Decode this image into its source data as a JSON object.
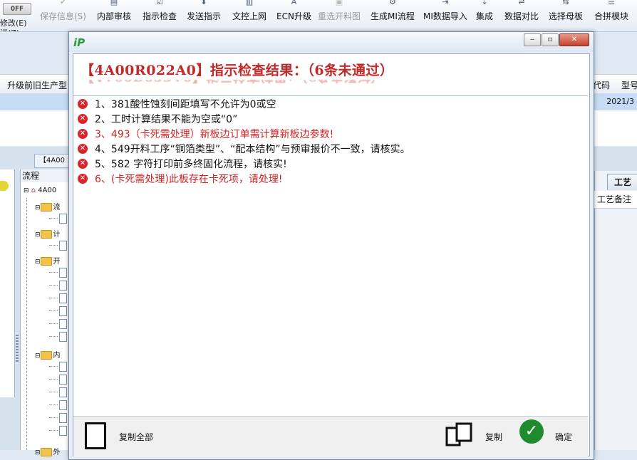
{
  "toolbar": {
    "switch_label": "OFF",
    "left_small_1": "修改(E)",
    "left_small_2": "消(Z)",
    "buttons": [
      {
        "label": "保存信息(S)",
        "icon": "check-icon",
        "disabled": true
      },
      {
        "label": "内部审核",
        "icon": "printer-icon"
      },
      {
        "label": "指示检查",
        "icon": "clipboard-check-icon"
      },
      {
        "label": "发送指示",
        "icon": "download-icon"
      },
      {
        "label": "文控上网",
        "icon": "document-icon"
      },
      {
        "label": "ECN升级",
        "icon": "letter-a-icon"
      },
      {
        "label": "重选开料图",
        "icon": "image-icon",
        "disabled": true
      },
      {
        "label": "生成MI流程",
        "icon": "gears-icon"
      },
      {
        "label": "MI数据导入",
        "icon": "import-icon"
      },
      {
        "label": "集成",
        "icon": "download-tray-icon"
      },
      {
        "label": "数据对比",
        "icon": "compare-icon"
      },
      {
        "label": "选择母板",
        "icon": "arrows-icon"
      },
      {
        "label": "合拼模块",
        "icon": "list-icon"
      }
    ]
  },
  "grid": {
    "col_left": "升级前旧生产型",
    "col_code": "代码",
    "col_model": "型号",
    "row_date": "2021/3"
  },
  "lower": {
    "tab_label": "【4A00",
    "tree_title": "流程",
    "tree_root": "4A00",
    "tree_nodes": [
      "流",
      "计",
      "开",
      "内",
      "外"
    ],
    "right_tab": "工艺",
    "right_header": "工艺备注"
  },
  "dialog": {
    "window_controls": {
      "minimize": "‒",
      "restore": "▫",
      "close": "✕"
    },
    "heading": "【4A00R022A0】指示检查结果：（6条未通过）",
    "messages": [
      {
        "text": "1、381酸性蚀刻间距填写不允许为0或空",
        "red": false
      },
      {
        "text": "2、工时计算结果不能为空或“0”",
        "red": false
      },
      {
        "text": "3、493（卡死需处理）新板边订单需计算新板边参数!",
        "red": true
      },
      {
        "text": "4、549开料工序“铜箔类型”、“配本结构”与预审报价不一致，请核实。",
        "red": false
      },
      {
        "text": "5、582 字符打印前多终固化流程，请核实!",
        "red": false
      },
      {
        "text": "6、(卡死需处理)此板存在卡死项，请处理!",
        "red": true
      }
    ],
    "footer": {
      "copy_all": "复制全部",
      "copy": "复制",
      "ok": "确定"
    }
  },
  "colors": {
    "heading_red": "#c42828",
    "error_red": "#d9262b",
    "ok_green": "#1f8a2e"
  }
}
